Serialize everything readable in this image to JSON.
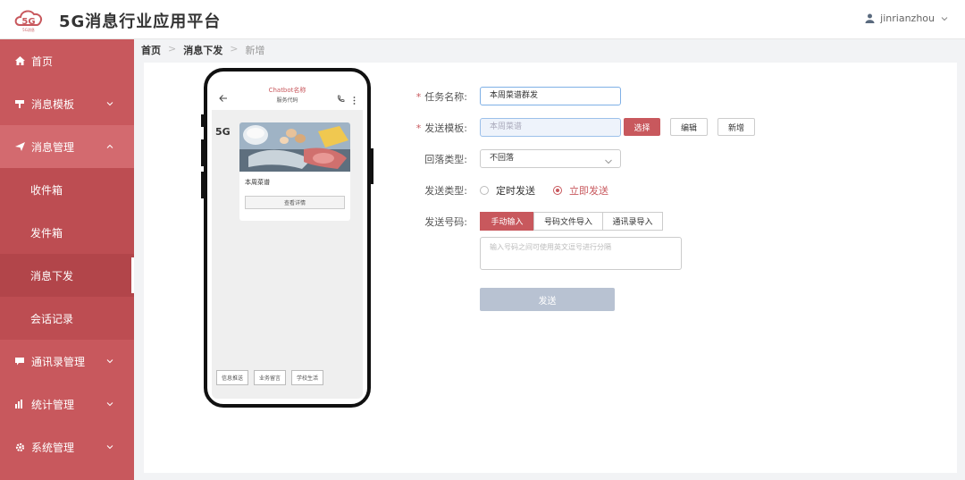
{
  "app": {
    "title": "5G消息行业应用平台",
    "logo_text": "5G",
    "logo_subtext": "5G消息",
    "user": "jinrianzhou"
  },
  "sidebar": {
    "items": [
      {
        "label": "首页",
        "icon": "home-icon"
      },
      {
        "label": "消息模板",
        "icon": "template-icon"
      },
      {
        "label": "消息管理",
        "icon": "send-icon",
        "expanded": true,
        "children": [
          "收件箱",
          "发件箱",
          "消息下发",
          "会话记录"
        ],
        "active_child": "消息下发"
      },
      {
        "label": "通讯录管理",
        "icon": "chat-icon"
      },
      {
        "label": "统计管理",
        "icon": "bar-chart-icon"
      },
      {
        "label": "系统管理",
        "icon": "gear-icon"
      }
    ]
  },
  "breadcrumb": [
    "首页",
    "消息下发",
    "新增"
  ],
  "phone": {
    "chat_title": "Chatbot名称",
    "chat_sub": "服务代码",
    "avatar": "5G",
    "card_title": "本周菜谱",
    "card_button": "查看详情",
    "quick_replies": [
      "信息推送",
      "业务留言",
      "学校生活"
    ]
  },
  "form": {
    "task_name_label": "任务名称:",
    "task_name_value": "本周菜谱群发",
    "template_label": "发送模板:",
    "template_value": "本周菜谱",
    "btn_select": "选择",
    "btn_edit": "编辑",
    "btn_new": "新增",
    "fallback_label": "回落类型:",
    "fallback_value": "不回落",
    "send_type_label": "发送类型:",
    "send_type_options": [
      "定时发送",
      "立即发送"
    ],
    "send_type_selected": "立即发送",
    "number_label": "发送号码:",
    "number_tabs": [
      "手动输入",
      "号码文件导入",
      "通讯录导入"
    ],
    "number_tab_active": "手动输入",
    "number_placeholder": "输入号码之间可使用英文逗号进行分隔",
    "submit": "发送"
  },
  "colors": {
    "accent": "#c8585d",
    "sidebar": "#c8585d",
    "disabled_button": "#b8c2d2"
  }
}
